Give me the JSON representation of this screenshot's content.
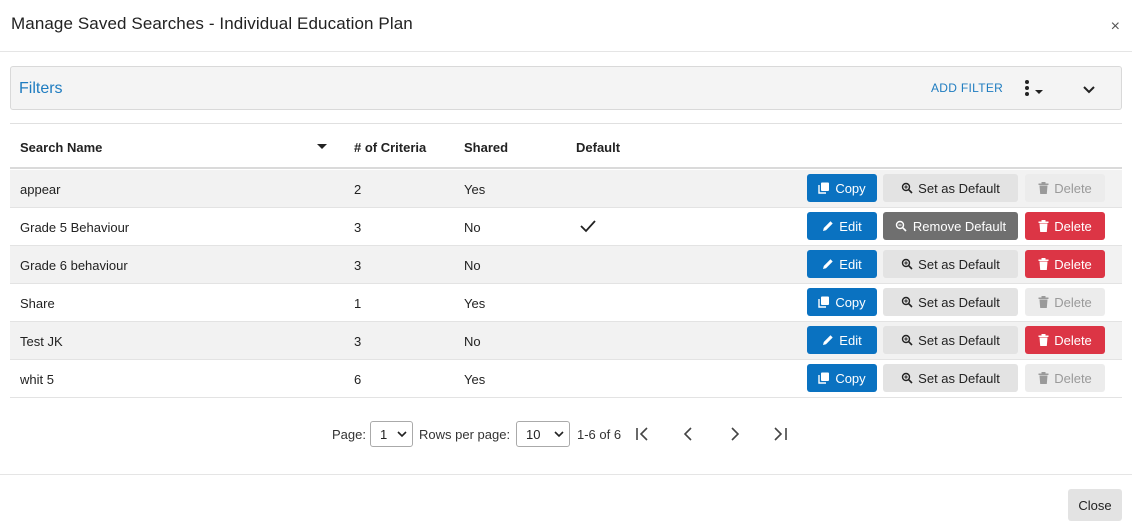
{
  "modal": {
    "title": "Manage Saved Searches - Individual Education Plan",
    "close_symbol": "×"
  },
  "filters": {
    "label": "Filters",
    "add_filter": "ADD FILTER"
  },
  "table": {
    "headers": {
      "name": "Search Name",
      "criteria": "# of Criteria",
      "shared": "Shared",
      "default": "Default"
    },
    "rows": [
      {
        "name": "appear",
        "criteria": "2",
        "shared": "Yes",
        "is_default": false,
        "primary": "Copy",
        "secondary": "Set as Default",
        "delete": "Delete",
        "delete_enabled": false
      },
      {
        "name": "Grade 5 Behaviour",
        "criteria": "3",
        "shared": "No",
        "is_default": true,
        "primary": "Edit",
        "secondary": "Remove Default",
        "delete": "Delete",
        "delete_enabled": true
      },
      {
        "name": "Grade 6 behaviour",
        "criteria": "3",
        "shared": "No",
        "is_default": false,
        "primary": "Edit",
        "secondary": "Set as Default",
        "delete": "Delete",
        "delete_enabled": true
      },
      {
        "name": "Share",
        "criteria": "1",
        "shared": "Yes",
        "is_default": false,
        "primary": "Copy",
        "secondary": "Set as Default",
        "delete": "Delete",
        "delete_enabled": false
      },
      {
        "name": "Test JK",
        "criteria": "3",
        "shared": "No",
        "is_default": false,
        "primary": "Edit",
        "secondary": "Set as Default",
        "delete": "Delete",
        "delete_enabled": true
      },
      {
        "name": "whit 5",
        "criteria": "6",
        "shared": "Yes",
        "is_default": false,
        "primary": "Copy",
        "secondary": "Set as Default",
        "delete": "Delete",
        "delete_enabled": false
      }
    ]
  },
  "pagination": {
    "page_label": "Page:",
    "page_value": "1",
    "rows_label": "Rows per page:",
    "rows_value": "10",
    "range": "1-6 of 6"
  },
  "footer": {
    "close_label": "Close"
  },
  "icons": {
    "header_close": "close-icon",
    "options": "more-vertical-icon",
    "collapse": "chevron-down-icon",
    "sort": "sort-desc-icon",
    "default_check": "checkmark-icon",
    "copy": "copy-icon",
    "edit": "pencil-icon",
    "set_default": "zoom-icon",
    "remove_default": "remove-search-icon",
    "delete": "trash-icon",
    "first_page": "first-page-icon",
    "prev_page": "chevron-left-icon",
    "next_page": "chevron-right-icon",
    "last_page": "last-page-icon"
  },
  "colors": {
    "primary": "#0a72c1",
    "danger": "#dc3545",
    "link": "#1e7cc0",
    "neutral": "#e3e3e3",
    "neutral_dark": "#6f6f6f"
  }
}
